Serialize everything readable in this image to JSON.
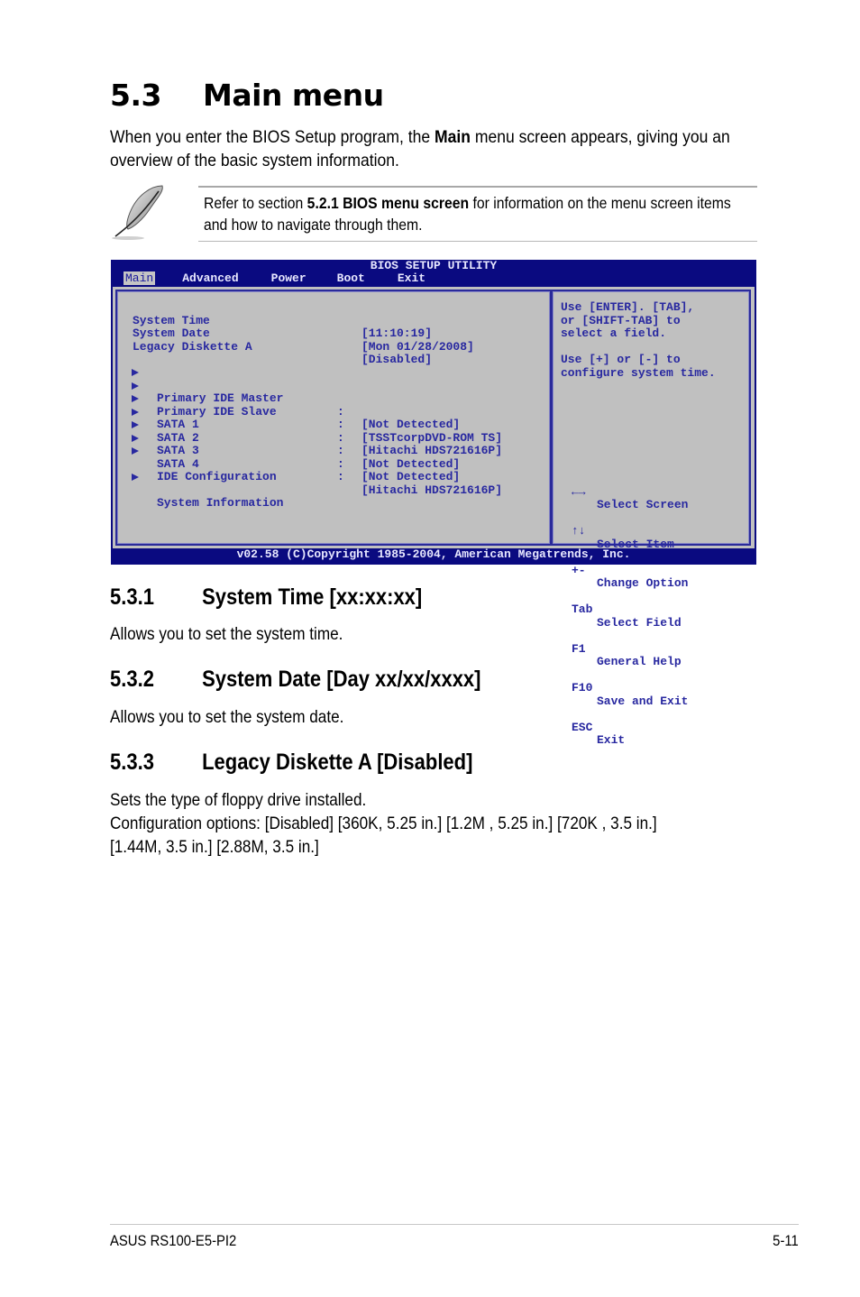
{
  "page": {
    "section_number": "5.3",
    "section_title": "Main menu",
    "intro": {
      "before": "When you enter the BIOS Setup program, the ",
      "bold": "Main",
      "after": " menu screen appears, giving you an overview of the basic system information."
    },
    "note": {
      "icon": "quill-pen-icon",
      "before": "Refer to section ",
      "bold": "5.2.1 BIOS menu screen",
      "after": " for information on the menu screen items and how to navigate through them."
    }
  },
  "bios": {
    "title": "BIOS SETUP UTILITY",
    "tabs": [
      {
        "label": "Main",
        "active": true
      },
      {
        "label": "Advanced",
        "active": false
      },
      {
        "label": "Power",
        "active": false
      },
      {
        "label": "Boot",
        "active": false
      },
      {
        "label": "Exit",
        "active": false
      }
    ],
    "settings": [
      {
        "label": "System Time",
        "value": "[11:10:19]"
      },
      {
        "label": "System Date",
        "value": "[Mon 01/28/2008]"
      },
      {
        "label": "Legacy Diskette A",
        "value": "[Disabled]"
      }
    ],
    "submenus": [
      {
        "label": "Primary IDE Master",
        "separator": ":",
        "value": "[Not Detected]"
      },
      {
        "label": "Primary IDE Slave",
        "separator": ":",
        "value": "[TSSTcorpDVD-ROM TS]"
      },
      {
        "label": "SATA 1",
        "separator": ":",
        "value": "[Hitachi HDS721616P]"
      },
      {
        "label": "SATA 2",
        "separator": ":",
        "value": "[Not Detected]"
      },
      {
        "label": "SATA 3",
        "separator": ":",
        "value": "[Not Detected]"
      },
      {
        "label": "SATA 4",
        "separator": ":",
        "value": "[Hitachi HDS721616P]"
      },
      {
        "label": "IDE Configuration",
        "separator": "",
        "value": ""
      },
      {
        "label": "System Information",
        "separator": "",
        "value": ""
      }
    ],
    "help_lines": [
      "Use [ENTER]. [TAB],",
      "or [SHIFT-TAB] to",
      "select a field.",
      "",
      "Use [+] or [-] to",
      "configure system time."
    ],
    "keys": [
      {
        "key": "←→",
        "desc": "Select Screen",
        "icon": "left-right-arrows-icon"
      },
      {
        "key": "↑↓",
        "desc": "Select Item",
        "icon": "up-down-arrows-icon"
      },
      {
        "key": "+-",
        "desc": "Change Option"
      },
      {
        "key": "Tab",
        "desc": "Select Field"
      },
      {
        "key": "F1",
        "desc": "General Help"
      },
      {
        "key": "F10",
        "desc": "Save and Exit"
      },
      {
        "key": "ESC",
        "desc": "Exit"
      }
    ],
    "footer": "v02.58 (C)Copyright 1985-2004, American Megatrends, Inc.",
    "colors": {
      "frame_blue": "#0a0a80",
      "panel_gray": "#c0c0c0",
      "text_blue": "#2828a0",
      "header_text": "#e8e8ff"
    }
  },
  "sections": [
    {
      "number": "5.3.1",
      "title": "System Time [xx:xx:xx]",
      "body": [
        "Allows you to set the system time."
      ]
    },
    {
      "number": "5.3.2",
      "title": "System Date [Day xx/xx/xxxx]",
      "body": [
        "Allows you to set the system date."
      ]
    },
    {
      "number": "5.3.3",
      "title": "Legacy Diskette A [Disabled]",
      "body": [
        "Sets the type of floppy drive installed.",
        "Configuration options: [Disabled] [360K, 5.25 in.] [1.2M , 5.25 in.] [720K , 3.5 in.]",
        "[1.44M, 3.5 in.] [2.88M, 3.5 in.]"
      ]
    }
  ],
  "footer": {
    "product": "ASUS RS100-E5-PI2",
    "page_number": "5-11"
  }
}
